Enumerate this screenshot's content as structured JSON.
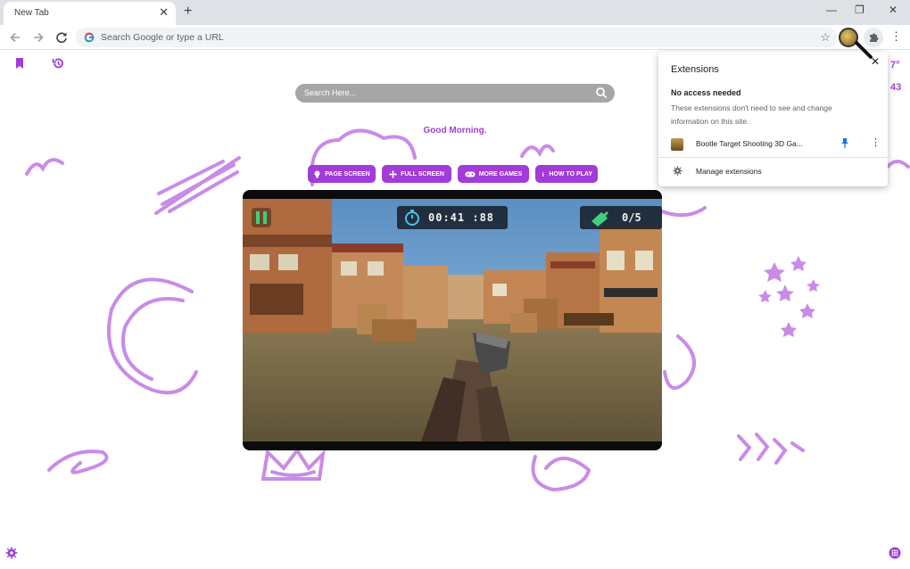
{
  "browser": {
    "tab_title": "New Tab",
    "tab_close": "✕",
    "new_tab": "+",
    "omnibox_placeholder": "Search Google or type a URL",
    "star": "☆",
    "menu": "⋮",
    "minimize": "—",
    "restore": "❐",
    "close": "✕"
  },
  "page": {
    "search_placeholder": "Search Here...",
    "greeting": "Good Morning.",
    "buttons": [
      {
        "label": "PAGE SCREEN",
        "icon": "bulb-icon"
      },
      {
        "label": "FULL SCREEN",
        "icon": "move-arrows-icon"
      },
      {
        "label": "MORE GAMES",
        "icon": "gamepad-icon"
      },
      {
        "label": "HOW TO PLAY",
        "icon": "info-icon"
      }
    ],
    "right_edge_text_1": "7°",
    "right_edge_text_2": "43",
    "accent": "#a23bd8"
  },
  "game": {
    "timer": "00:41 :88",
    "bottle_count": "0/5"
  },
  "extensions_popup": {
    "title": "Extensions",
    "close": "✕",
    "section_title": "No access needed",
    "section_desc": "These extensions don't need to see and change information on this site.",
    "extension_name": "Bootle Target Shooting 3D Ga...",
    "more": "⋮",
    "manage": "Manage extensions"
  }
}
